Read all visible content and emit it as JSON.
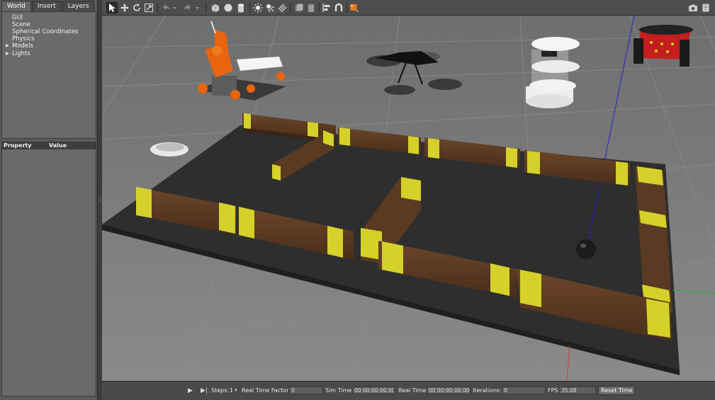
{
  "tabs": [
    {
      "label": "World"
    },
    {
      "label": "Insert"
    },
    {
      "label": "Layers"
    }
  ],
  "tree": {
    "items": [
      {
        "label": "GUI"
      },
      {
        "label": "Scene"
      },
      {
        "label": "Spherical Coordinates"
      },
      {
        "label": "Physics"
      },
      {
        "label": "Models",
        "expandable": true
      },
      {
        "label": "Lights",
        "expandable": true
      }
    ]
  },
  "properties": {
    "col_property": "Property",
    "col_value": "Value"
  },
  "toolbar": {
    "icons": [
      "select-mode-icon",
      "translate-mode-icon",
      "rotate-mode-icon",
      "scale-mode-icon",
      "undo-icon",
      "undo-dropdown-icon",
      "redo-icon",
      "redo-dropdown-icon",
      "box-shape-icon",
      "sphere-shape-icon",
      "cylinder-shape-icon",
      "point-light-icon",
      "spot-light-icon",
      "directional-light-icon",
      "copy-icon",
      "paste-icon",
      "align-icon",
      "snap-icon",
      "change-view-icon",
      "screenshot-icon",
      "record-icon"
    ]
  },
  "bottom": {
    "steps_label": "Steps:",
    "steps_value": "1",
    "rtf_label": "Real Time Factor:",
    "rtf_value": "0",
    "sim_time_label": "Sim Time:",
    "sim_time_value": "00 00:00:00.000",
    "real_time_label": "Real Time:",
    "real_time_value": "00 00:00:00.000",
    "iterations_label": "Iterations:",
    "iterations_value": "0",
    "fps_label": "FPS:",
    "fps_value": "35.08",
    "reset_label": "Reset Time"
  },
  "colors": {
    "panel": "#5a5a5a",
    "ground": "#7b7b7b",
    "platform": "#2f2f2f",
    "wall": "#5a3a22",
    "stripe": "#d4d12a",
    "axis_z": "#2222cc"
  }
}
